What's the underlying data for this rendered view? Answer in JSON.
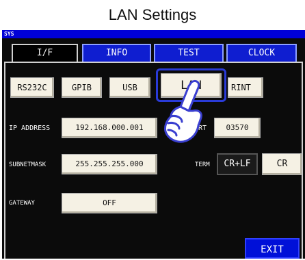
{
  "title": "LAN Settings",
  "sysbar_label": "SYS",
  "tabs": [
    {
      "label": "I/F"
    },
    {
      "label": "INFO"
    },
    {
      "label": "TEST"
    },
    {
      "label": "CLOCK"
    }
  ],
  "interfaces": [
    {
      "label": "RS232C"
    },
    {
      "label": "GPIB"
    },
    {
      "label": "USB"
    },
    {
      "label": "LAN"
    },
    {
      "label": "RINT"
    }
  ],
  "ip_address": {
    "label": "IP ADDRESS",
    "value": "192.168.000.001"
  },
  "port": {
    "label": "PORT",
    "value": "03570"
  },
  "subnet": {
    "label": "SUBNETMASK",
    "value": "255.255.255.000"
  },
  "term": {
    "label": "TERM",
    "options": [
      "CR+LF",
      "CR"
    ],
    "selected": "CR+LF"
  },
  "gateway": {
    "label": "GATEWAY",
    "value": "OFF"
  },
  "exit_label": "EXIT",
  "colors": {
    "accent": "#0010d8",
    "tab_blue": "#0f1ed0",
    "button_bg": "#f5f1e4"
  }
}
